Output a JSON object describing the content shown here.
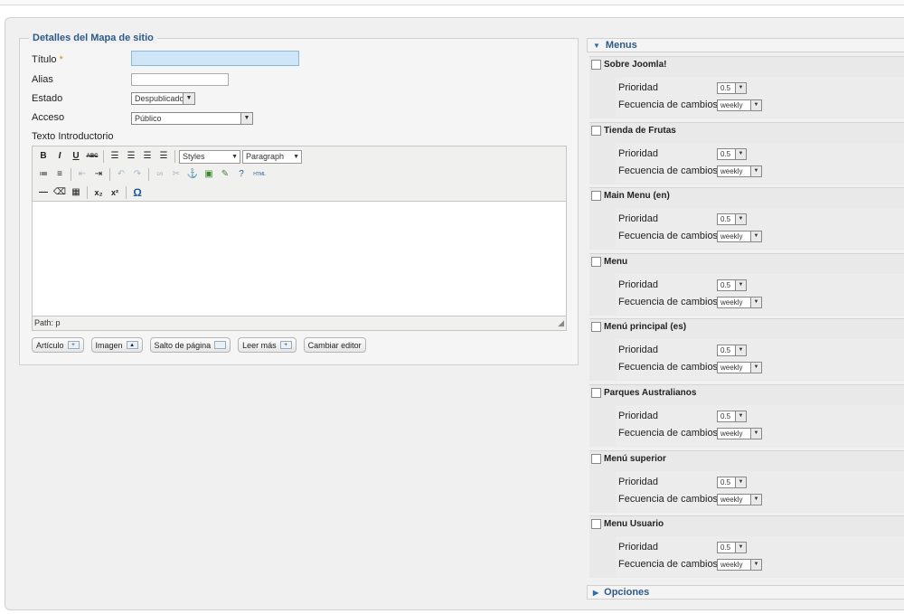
{
  "form": {
    "legend": "Detalles del Mapa de sitio",
    "titulo_label": "Título",
    "required_mark": "*",
    "titulo_value": "",
    "alias_label": "Alias",
    "alias_value": "",
    "estado_label": "Estado",
    "estado_value": "Despublicado",
    "acceso_label": "Acceso",
    "acceso_value": "Público",
    "texto_label": "Texto Introductorio"
  },
  "editor": {
    "styles_value": "Styles",
    "format_value": "Paragraph",
    "path_text": "Path: p",
    "icons": {
      "bold": "B",
      "italic": "I",
      "underline": "U",
      "strike": "ABC",
      "html": "HTML",
      "subscript": "x₂",
      "superscript": "x²",
      "omega": "Ω"
    }
  },
  "editor_buttons": [
    {
      "label": "Artículo"
    },
    {
      "label": "Imagen"
    },
    {
      "label": "Salto de página"
    },
    {
      "label": "Leer más"
    },
    {
      "label": "Cambiar editor"
    }
  ],
  "menus_panel": {
    "title": "Menus",
    "priority_label": "Prioridad",
    "frequency_label": "Fecuencia de cambios",
    "items": [
      {
        "name": "Sobre Joomla!",
        "priority": "0.5",
        "frequency": "weekly"
      },
      {
        "name": "Tienda de Frutas",
        "priority": "0.5",
        "frequency": "weekly"
      },
      {
        "name": "Main Menu (en)",
        "priority": "0.5",
        "frequency": "weekly"
      },
      {
        "name": "Menu",
        "priority": "0.5",
        "frequency": "weekly"
      },
      {
        "name": "Menú principal (es)",
        "priority": "0.5",
        "frequency": "weekly"
      },
      {
        "name": "Parques Australianos",
        "priority": "0.5",
        "frequency": "weekly"
      },
      {
        "name": "Menú superior",
        "priority": "0.5",
        "frequency": "weekly"
      },
      {
        "name": "Menu Usuario",
        "priority": "0.5",
        "frequency": "weekly"
      }
    ]
  },
  "options_panel": {
    "title": "Opciones"
  }
}
